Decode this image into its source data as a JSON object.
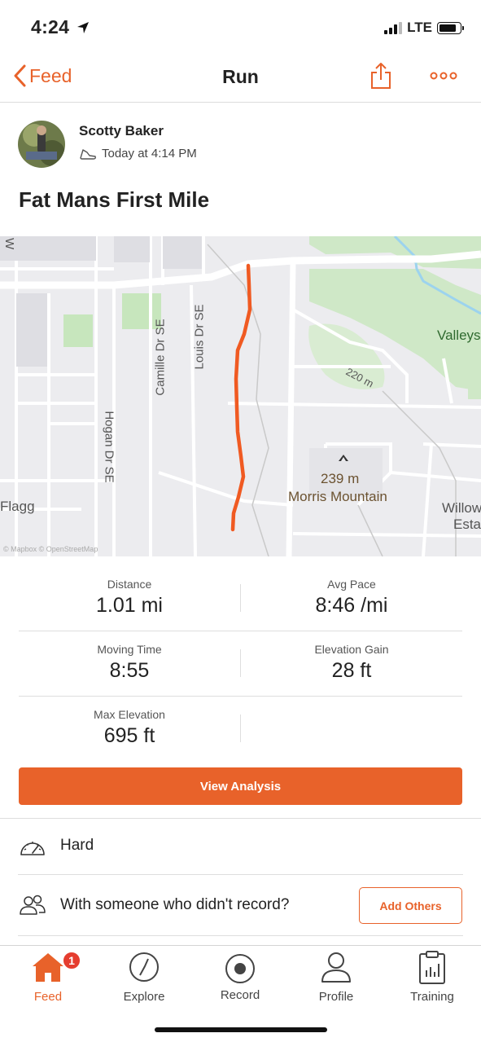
{
  "status_bar": {
    "time": "4:24",
    "network": "LTE",
    "location_icon": "location-arrow-icon",
    "signal_icon": "cellular-signal-icon",
    "battery_icon": "battery-icon",
    "battery_level": 0.85
  },
  "nav": {
    "back_label": "Feed",
    "back_icon": "chevron-left-icon",
    "title": "Run",
    "share_icon": "share-icon",
    "more_icon": "more-horizontal-icon"
  },
  "athlete": {
    "name": "Scotty Baker",
    "timestamp": "Today at 4:14 PM",
    "activity_icon": "running-shoe-icon"
  },
  "activity": {
    "title": "Fat Mans First Mile"
  },
  "map": {
    "labels": {
      "camille": "Camille Dr SE",
      "louis": "Louis Dr SE",
      "hogan": "Hogan Dr SE",
      "contour": "220 m",
      "peak_elevation": "239 m",
      "peak_name": "Morris Mountain",
      "valleys": "Valleys",
      "flagg": "Flagg",
      "willow": "Willow",
      "esta": "Esta",
      "w": "W",
      "attribution": "© Mapbox © OpenStreetMap"
    },
    "route_color": "#f05a22",
    "peak_icon": "mountain-peak-icon"
  },
  "stats": {
    "distance": {
      "label": "Distance",
      "value": "1.01 mi"
    },
    "avg_pace": {
      "label": "Avg Pace",
      "value": "8:46 /mi"
    },
    "moving_time": {
      "label": "Moving Time",
      "value": "8:55"
    },
    "elevation_gain": {
      "label": "Elevation Gain",
      "value": "28 ft"
    },
    "max_elevation": {
      "label": "Max Elevation",
      "value": "695 ft"
    }
  },
  "actions": {
    "view_analysis": "View Analysis"
  },
  "effort": {
    "label": "Hard",
    "icon": "gauge-icon"
  },
  "others": {
    "label": "With someone who didn't record?",
    "icon": "people-icon",
    "button": "Add Others"
  },
  "tabs": [
    {
      "label": "Feed",
      "icon": "home-icon",
      "badge": "1",
      "active": true
    },
    {
      "label": "Explore",
      "icon": "compass-icon",
      "active": false
    },
    {
      "label": "Record",
      "icon": "record-icon",
      "active": false
    },
    {
      "label": "Profile",
      "icon": "profile-icon",
      "active": false
    },
    {
      "label": "Training",
      "icon": "training-log-icon",
      "active": false
    }
  ],
  "colors": {
    "accent": "#e8622a",
    "badge": "#e53d2f",
    "map_background": "#ececef",
    "park": "#cfe8c7"
  }
}
